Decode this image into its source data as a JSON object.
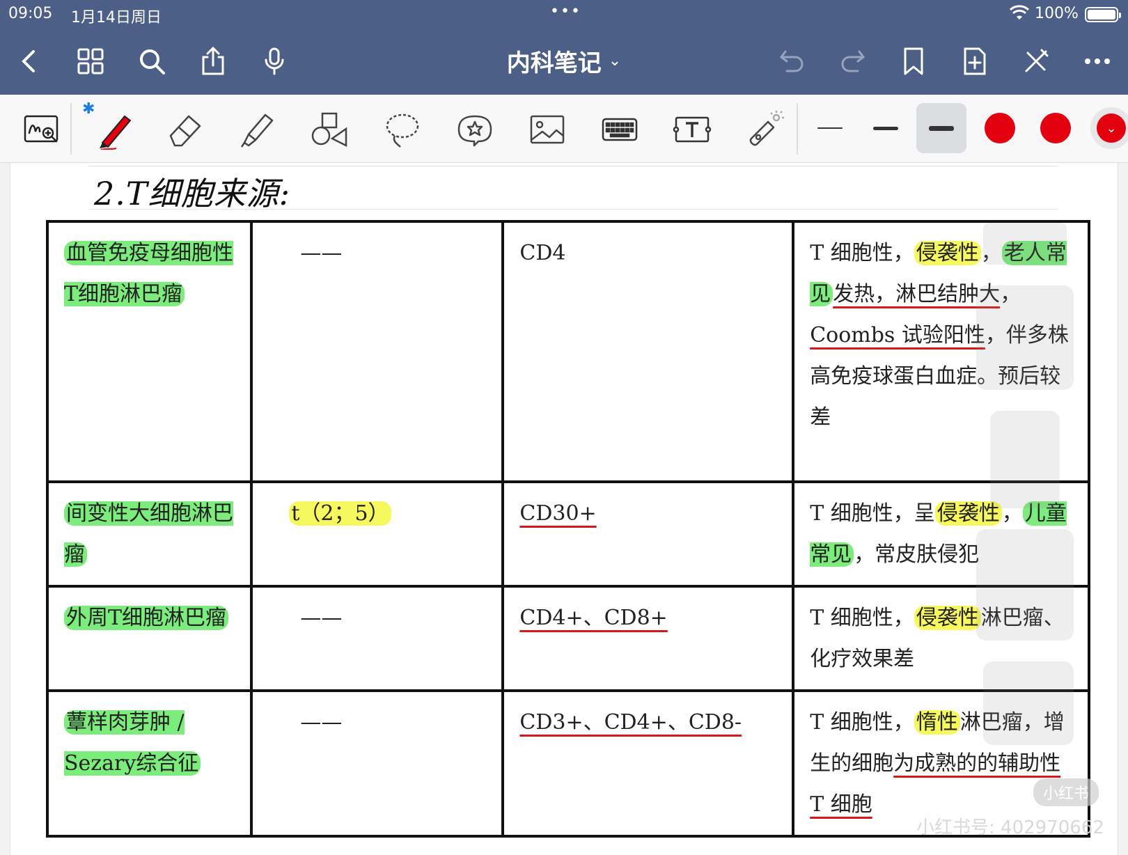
{
  "status_bar": {
    "time": "09:05",
    "date": "1月14日周日",
    "dots": "•••",
    "battery_text": "100%"
  },
  "nav_bar": {
    "title": "内科笔记",
    "title_chevron": "⌄",
    "icons": [
      "back-icon",
      "grid-icon",
      "search-icon",
      "share-icon",
      "microphone-icon",
      "undo-icon",
      "redo-icon",
      "bookmark-icon",
      "add-page-icon",
      "close-pen-icon",
      "more-icon"
    ]
  },
  "toolbar": {
    "tools": [
      "handwriting-zoom-icon",
      "pen-icon",
      "eraser-icon",
      "highlighter-icon",
      "shapes-icon",
      "lasso-icon",
      "sticker-icon",
      "image-icon",
      "keyboard-icon",
      "text-box-icon",
      "laser-pointer-icon"
    ],
    "pen_color": "#e3000f",
    "swatch_colors": [
      "#e3000f",
      "#e3000f",
      "#e3000f"
    ],
    "swatch_more_glyph": "⌄",
    "bluetooth_glyph": "✱"
  },
  "page": {
    "heading": "2.T细胞来源:",
    "table": {
      "rows": [
        {
          "name": "血管免疫母细胞性T细胞淋巴瘤",
          "translocation": "——",
          "markers": "CD4",
          "features": [
            {
              "text": "T 细胞性，"
            },
            {
              "text": "侵袭性",
              "hl": "yellow"
            },
            {
              "text": "，"
            },
            {
              "text": "老人常见",
              "hl": "green"
            },
            {
              "text": "发热，淋巴结肿大",
              "ul": true
            },
            {
              "text": "，"
            },
            {
              "text": "Coombs 试验阳性",
              "ul": true
            },
            {
              "text": "，伴多株高免疫球蛋白血症。预后较差"
            }
          ]
        },
        {
          "name": "间变性大细胞淋巴瘤",
          "translocation": "t（2；5）",
          "markers": "CD30+",
          "features": [
            {
              "text": "T 细胞性，呈"
            },
            {
              "text": "侵袭性",
              "hl": "yellow"
            },
            {
              "text": "，"
            },
            {
              "text": "儿童常见",
              "hl": "green"
            },
            {
              "text": "，常皮肤侵犯"
            }
          ]
        },
        {
          "name": "外周T细胞淋巴瘤",
          "translocation": "——",
          "markers": "CD4+、CD8+",
          "features": [
            {
              "text": "T 细胞性，"
            },
            {
              "text": "侵袭性",
              "hl": "yellow"
            },
            {
              "text": "淋巴瘤、化疗效果差"
            }
          ]
        },
        {
          "name": "蕈样肉芽肿 / Sezary综合征",
          "translocation": "——",
          "markers": "CD3+、CD4+、CD8-",
          "features": [
            {
              "text": "T 细胞性，"
            },
            {
              "text": "惰性",
              "hl": "yellow"
            },
            {
              "text": "淋巴瘤，增生的细胞"
            },
            {
              "text": "为成熟的的辅助性 T 细胞",
              "ul": true
            }
          ]
        }
      ]
    }
  },
  "watermark": {
    "badge": "小红书",
    "id_text": "小红书号: 402970662"
  }
}
